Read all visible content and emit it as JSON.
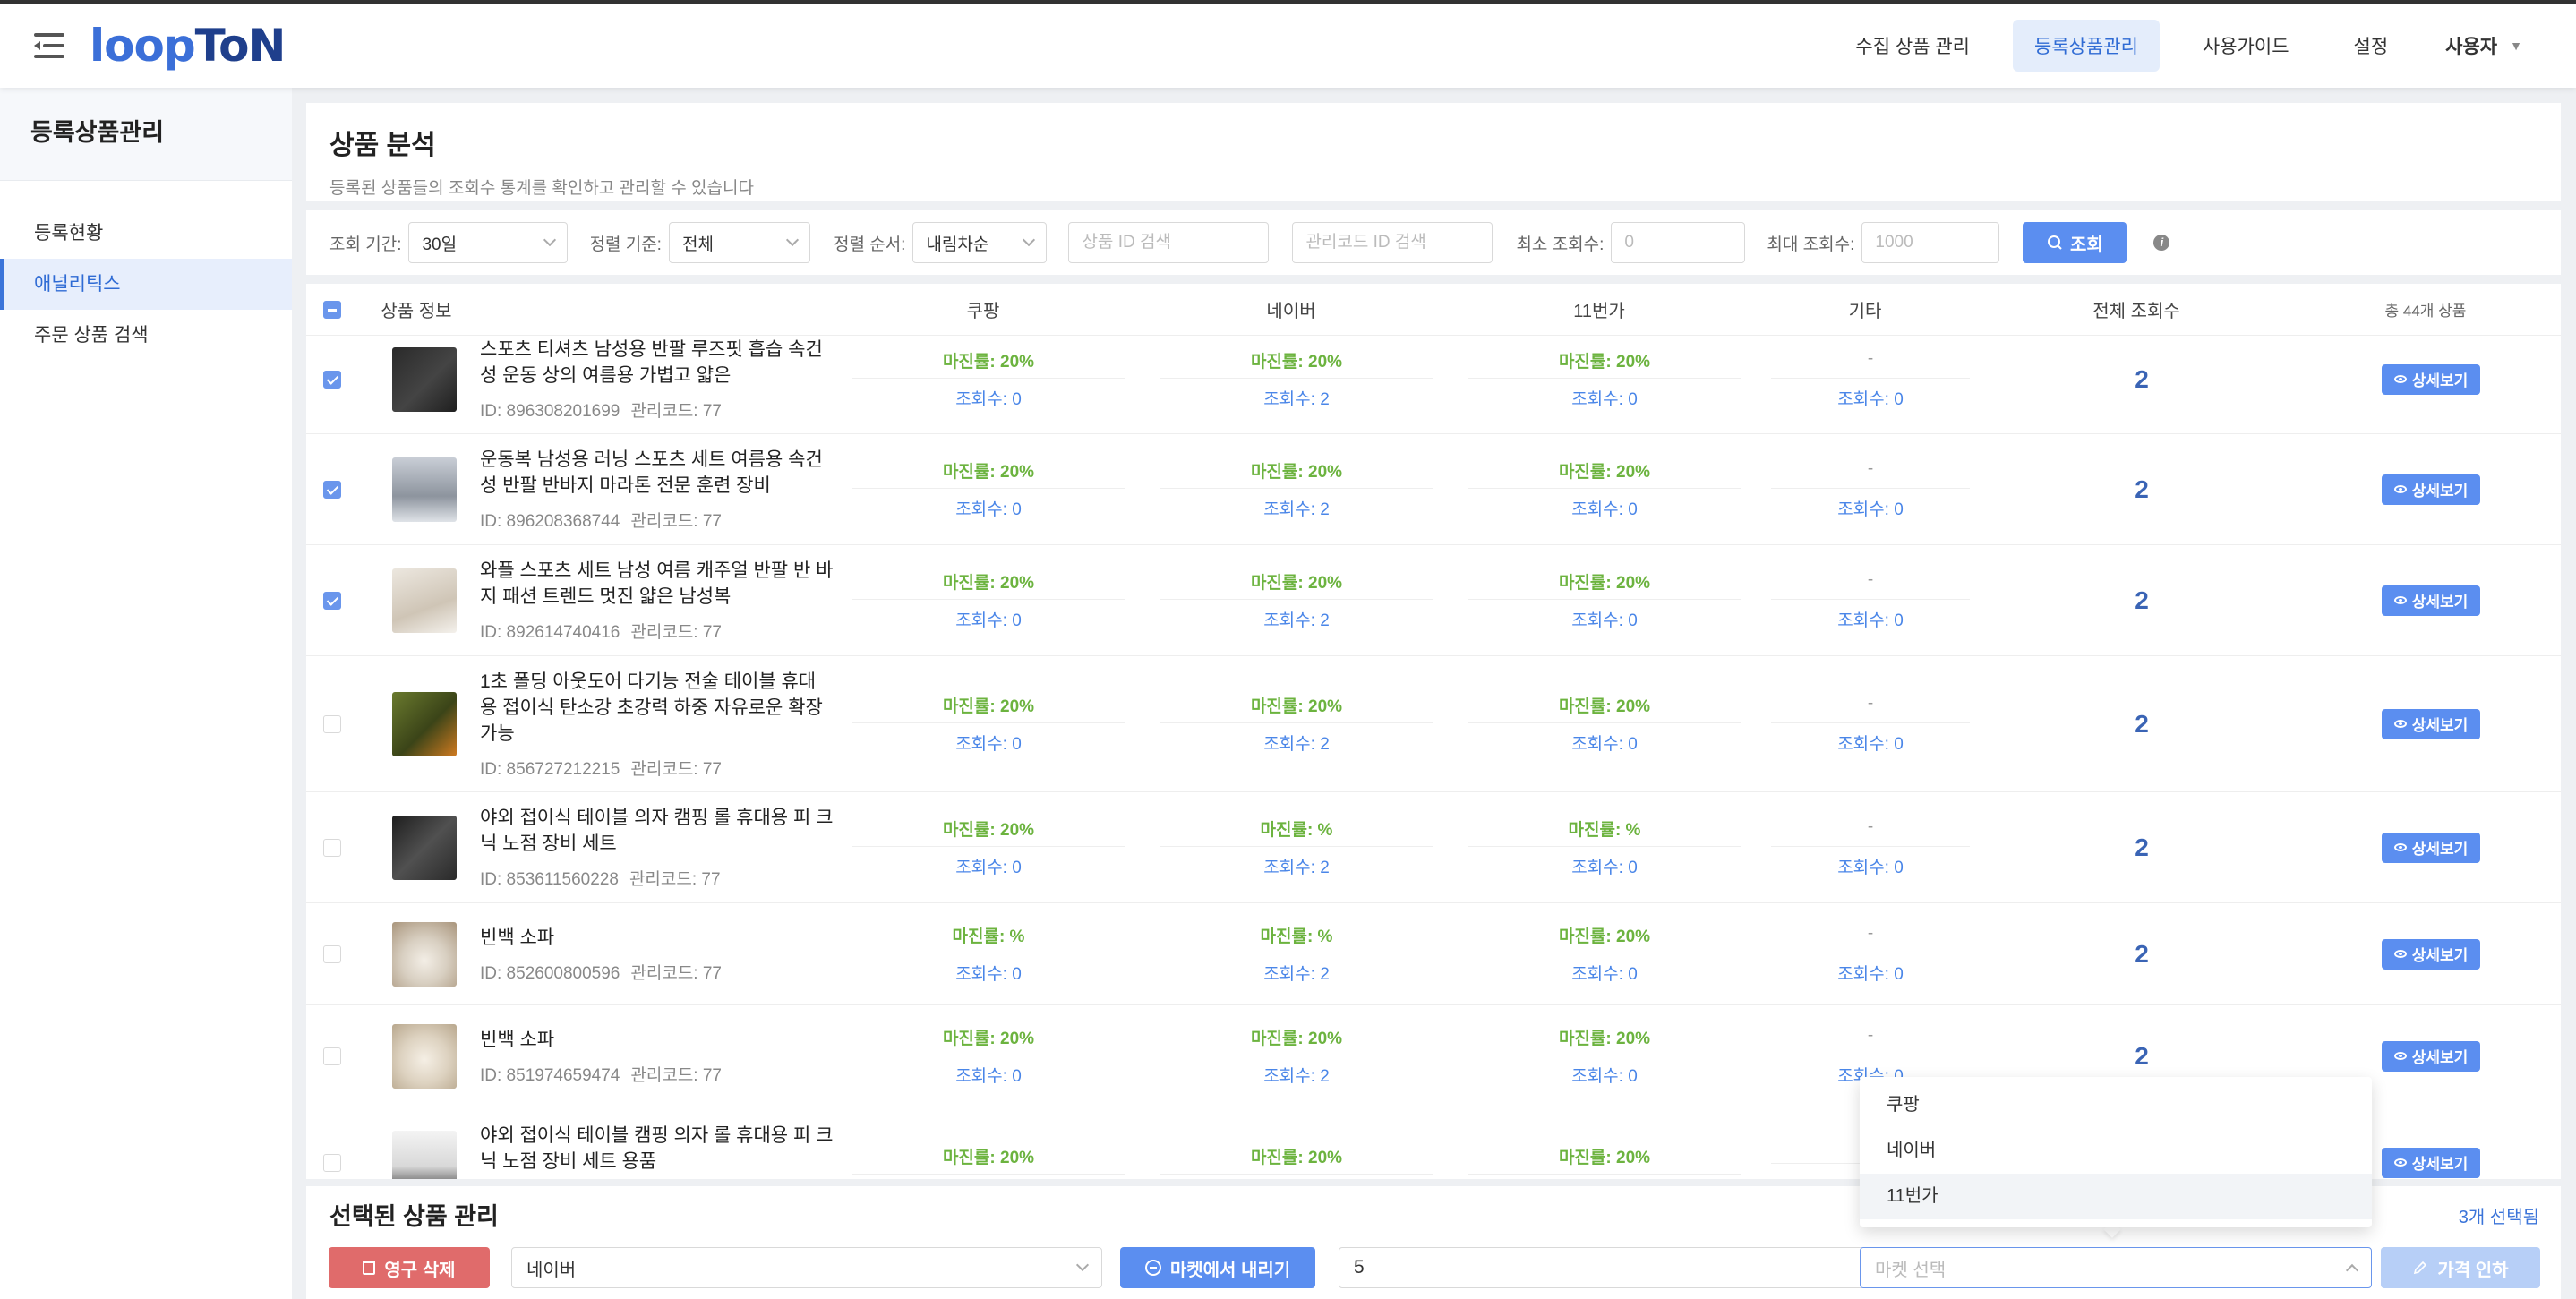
{
  "brand": {
    "logo_a": "loop",
    "logo_b": "ToN"
  },
  "nav": {
    "items": [
      {
        "label": "수집 상품 관리"
      },
      {
        "label": "등록상품관리"
      },
      {
        "label": "사용가이드"
      },
      {
        "label": "설정"
      }
    ],
    "user": "사용자"
  },
  "sidebar": {
    "title": "등록상품관리",
    "items": [
      {
        "label": "등록현황"
      },
      {
        "label": "애널리틱스"
      },
      {
        "label": "주문 상품 검색"
      }
    ]
  },
  "page": {
    "title": "상품 분석",
    "desc": "등록된 상품들의 조회수 통계를 확인하고 관리할 수 있습니다"
  },
  "filters": {
    "period_label": "조회 기간:",
    "period_value": "30일",
    "sort_label": "정렬 기준:",
    "sort_value": "전체",
    "order_label": "정렬 순서:",
    "order_value": "내림차순",
    "product_id_placeholder": "상품 ID 검색",
    "code_placeholder": "관리코드 ID 검색",
    "min_label": "최소 조회수:",
    "min_placeholder": "0",
    "max_label": "최대 조회수:",
    "max_placeholder": "1000",
    "search_button": "조회"
  },
  "table": {
    "headers": {
      "product": "상품 정보",
      "coupang": "쿠팡",
      "naver": "네이버",
      "st11": "11번가",
      "etc": "기타",
      "total": "전체 조회수",
      "count": "총 44개 상품"
    },
    "detail_label": "상세보기",
    "rows": [
      {
        "name": "스포츠 티셔츠 남성용 반팔 루즈핏 흡습 속건 성 운동 상의 여름용 가볍고 얇은",
        "id": "ID: 896308201699",
        "code": "관리코드: 77",
        "checked": true,
        "coupang_margin": "마진률: 20%",
        "coupang_views": "조회수: 0",
        "naver_margin": "마진률: 20%",
        "naver_views": "조회수: 2",
        "st11_margin": "마진률: 20%",
        "st11_views": "조회수: 0",
        "etc_margin": "-",
        "etc_views": "조회수: 0",
        "total": "2"
      },
      {
        "name": "운동복 남성용 러닝 스포츠 세트 여름용 속건 성 반팔 반바지 마라톤 전문 훈련 장비",
        "id": "ID: 896208368744",
        "code": "관리코드: 77",
        "checked": true,
        "coupang_margin": "마진률: 20%",
        "coupang_views": "조회수: 0",
        "naver_margin": "마진률: 20%",
        "naver_views": "조회수: 2",
        "st11_margin": "마진률: 20%",
        "st11_views": "조회수: 0",
        "etc_margin": "-",
        "etc_views": "조회수: 0",
        "total": "2"
      },
      {
        "name": "와플 스포츠 세트 남성 여름 캐주얼 반팔 반 바지 패션 트렌드 멋진 얇은 남성복",
        "id": "ID: 892614740416",
        "code": "관리코드: 77",
        "checked": true,
        "coupang_margin": "마진률: 20%",
        "coupang_views": "조회수: 0",
        "naver_margin": "마진률: 20%",
        "naver_views": "조회수: 2",
        "st11_margin": "마진률: 20%",
        "st11_views": "조회수: 0",
        "etc_margin": "-",
        "etc_views": "조회수: 0",
        "total": "2"
      },
      {
        "name": "1초 폴딩 아웃도어 다기능 전술 테이블 휴대 용 접이식 탄소강 초강력 하중 자유로운 확장 가능",
        "id": "ID: 856727212215",
        "code": "관리코드: 77",
        "checked": false,
        "coupang_margin": "마진률: 20%",
        "coupang_views": "조회수: 0",
        "naver_margin": "마진률: 20%",
        "naver_views": "조회수: 2",
        "st11_margin": "마진률: 20%",
        "st11_views": "조회수: 0",
        "etc_margin": "-",
        "etc_views": "조회수: 0",
        "total": "2"
      },
      {
        "name": "야외 접이식 테이블 의자 캠핑 롤 휴대용 피 크닉 노점 장비 세트",
        "id": "ID: 853611560228",
        "code": "관리코드: 77",
        "checked": false,
        "coupang_margin": "마진률: 20%",
        "coupang_views": "조회수: 0",
        "naver_margin": "마진률: %",
        "naver_views": "조회수: 2",
        "st11_margin": "마진률: %",
        "st11_views": "조회수: 0",
        "etc_margin": "-",
        "etc_views": "조회수: 0",
        "total": "2"
      },
      {
        "name": "빈백 소파",
        "id": "ID: 852600800596",
        "code": "관리코드: 77",
        "checked": false,
        "coupang_margin": "마진률: %",
        "coupang_views": "조회수: 0",
        "naver_margin": "마진률: %",
        "naver_views": "조회수: 2",
        "st11_margin": "마진률: 20%",
        "st11_views": "조회수: 0",
        "etc_margin": "-",
        "etc_views": "조회수: 0",
        "total": "2"
      },
      {
        "name": "빈백 소파",
        "id": "ID: 851974659474",
        "code": "관리코드: 77",
        "checked": false,
        "coupang_margin": "마진률: 20%",
        "coupang_views": "조회수: 0",
        "naver_margin": "마진률: 20%",
        "naver_views": "조회수: 2",
        "st11_margin": "마진률: 20%",
        "st11_views": "조회수: 0",
        "etc_margin": "-",
        "etc_views": "조회수: 0",
        "total": "2"
      },
      {
        "name": "야외 접이식 테이블 캠핑 의자 롤 휴대용 피 크닉 노점 장비 세트 용품",
        "id": "",
        "code": "",
        "checked": false,
        "coupang_margin": "마진률: 20%",
        "coupang_views": "",
        "naver_margin": "마진률: 20%",
        "naver_views": "",
        "st11_margin": "마진률: 20%",
        "st11_views": "",
        "etc_margin": "",
        "etc_views": "",
        "total": ""
      }
    ]
  },
  "bulk": {
    "title": "선택된 상품 관리",
    "selected_count": "3개 선택됨",
    "delete_button": "영구 삭제",
    "market_value": "네이버",
    "remove_button": "마켓에서 내리기",
    "amount_value": "5",
    "market_placeholder": "마켓 선택",
    "price_button": "가격 인하"
  },
  "dropdown": {
    "options": [
      {
        "label": "쿠팡"
      },
      {
        "label": "네이버"
      },
      {
        "label": "11번가"
      }
    ]
  },
  "colors": {
    "accent": "#5b8ef0",
    "margin_green": "#6cb33f",
    "views_blue": "#4a86e8",
    "danger": "#e06b6b"
  }
}
